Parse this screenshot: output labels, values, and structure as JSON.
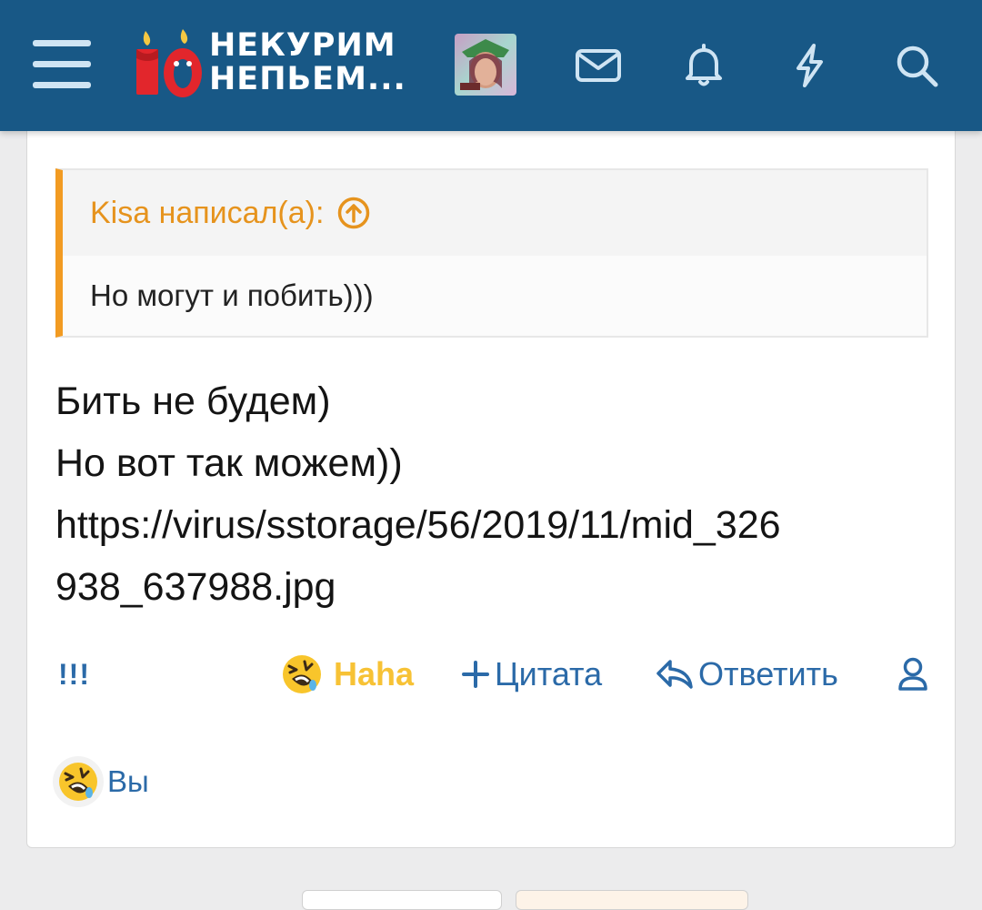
{
  "header": {
    "logo_line1": "НЕКУРИМ",
    "logo_line2": "НЕПЬЕМ...",
    "icons": [
      "menu-icon",
      "envelope-icon",
      "bell-icon",
      "lightning-icon",
      "search-icon"
    ],
    "brand_color": "#185886",
    "icon_color": "#cfe4f3"
  },
  "post": {
    "quote": {
      "author": "Kisa написал(а):",
      "text": "Но могут и побить)))",
      "accent_color": "#f29b22"
    },
    "message_lines": [
      "Бить не будем)",
      "Но вот так можем))",
      "https://virus/sstorage/56/2019/11/mid_326",
      "938_637988.jpg"
    ],
    "actions": {
      "warn": "!!!",
      "reaction": "Haha",
      "quote": "Цитата",
      "reply": "Ответить"
    },
    "reactions_summary": {
      "emoji": "laughing-emoji",
      "users": "Вы"
    }
  }
}
